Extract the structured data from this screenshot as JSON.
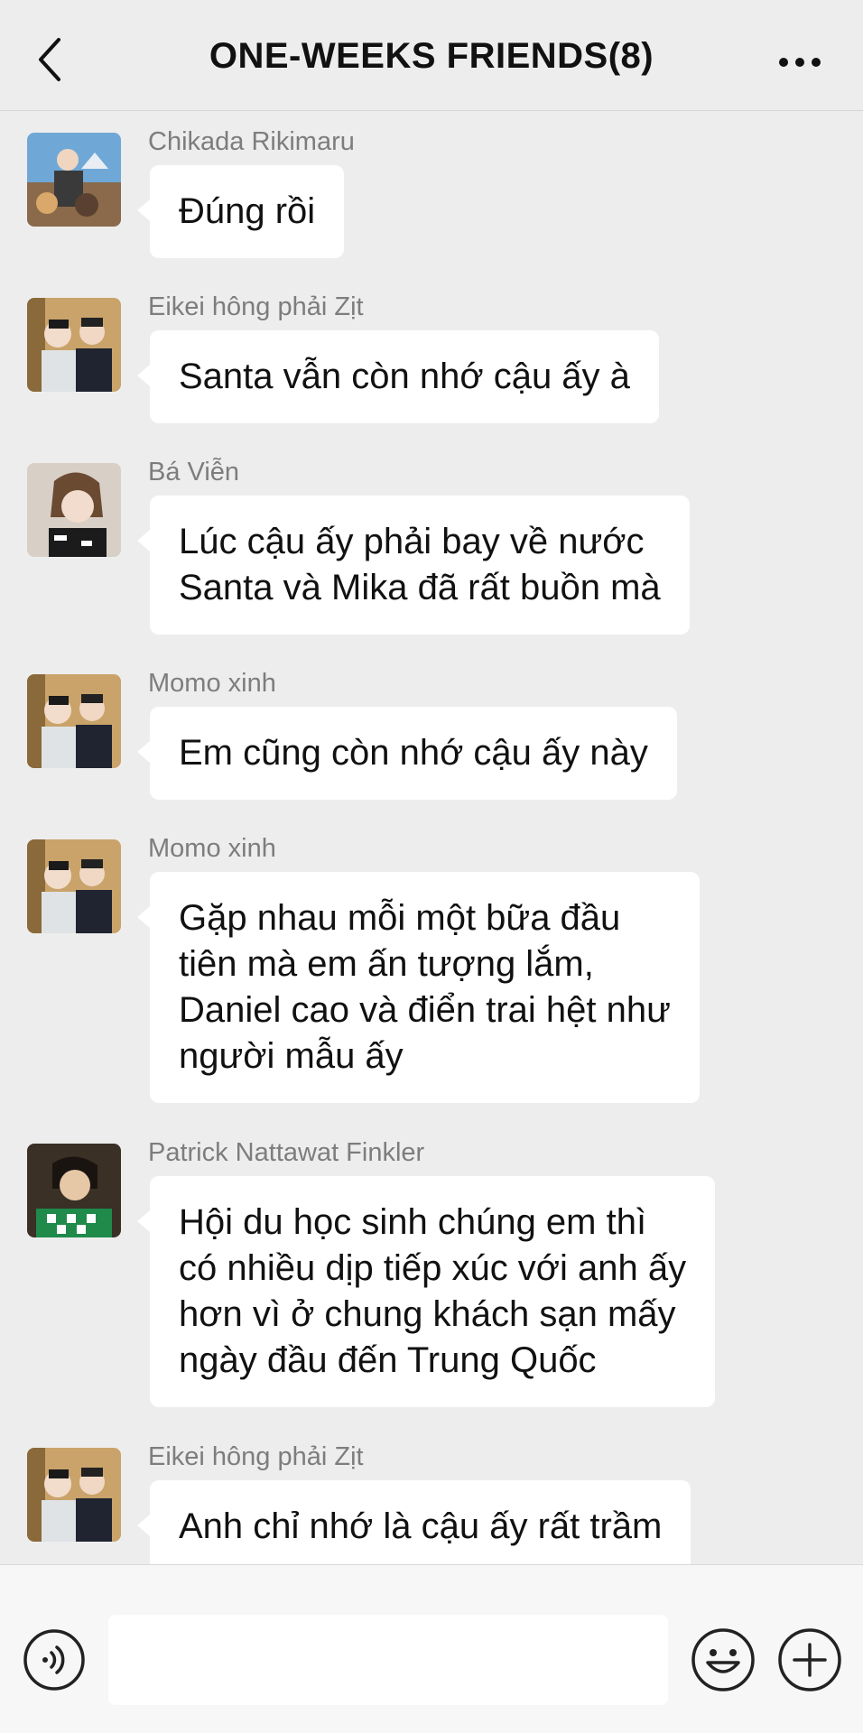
{
  "header": {
    "title": "ONE-WEEKS FRIENDS(8)",
    "back_icon": "chevron-left-icon",
    "more_icon": "ellipsis-icon"
  },
  "messages": [
    {
      "sender": "Chikada Rikimaru",
      "lines": [
        "Đúng rồi"
      ],
      "avatar": "avatar-photo-outdoor-dogs"
    },
    {
      "sender": "Eikei hông phải Zịt",
      "lines": [
        "Santa vẫn còn nhớ cậu ấy à"
      ],
      "avatar": "avatar-photo-two-people"
    },
    {
      "sender": "Bá Viễn",
      "lines": [
        "Lúc cậu ấy phải bay về nước",
        "Santa và Mika đã rất buồn mà"
      ],
      "avatar": "avatar-photo-portrait"
    },
    {
      "sender": "Momo xinh",
      "lines": [
        "Em cũng còn nhớ cậu ấy này"
      ],
      "avatar": "avatar-photo-two-people"
    },
    {
      "sender": "Momo xinh",
      "lines": [
        "Gặp nhau mỗi một bữa đầu",
        "tiên mà em ấn tượng lắm,",
        "Daniel cao và điển trai hệt như",
        "người mẫu ấy"
      ],
      "avatar": "avatar-photo-two-people"
    },
    {
      "sender": "Patrick Nattawat Finkler",
      "lines": [
        "Hội du học sinh chúng em thì",
        "có nhiều dịp tiếp xúc với anh ấy",
        "hơn vì ở chung khách sạn mấy",
        "ngày đầu đến Trung Quốc"
      ],
      "avatar": "avatar-photo-green-sweater"
    },
    {
      "sender": "Eikei hông phải Zịt",
      "lines": [
        "Anh chỉ nhớ là cậu ấy rất trầm"
      ],
      "avatar": "avatar-photo-two-people"
    }
  ],
  "input_bar": {
    "placeholder": "",
    "voice_icon": "voice-icon",
    "emoji_icon": "emoji-icon",
    "plus_icon": "plus-icon"
  },
  "colors": {
    "background": "#ededed",
    "bubble": "#ffffff",
    "sender_text": "#7d7d7d"
  }
}
